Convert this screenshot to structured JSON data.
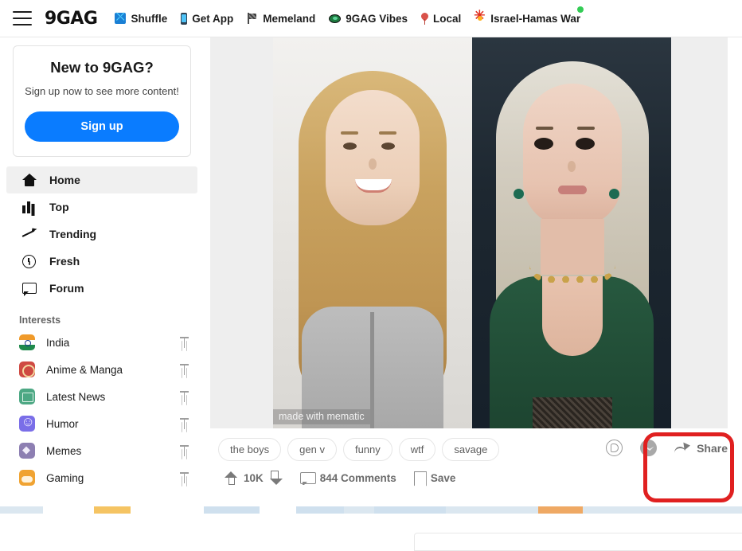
{
  "header": {
    "menu_icon": "hamburger-icon",
    "logo": "9GAG",
    "links": [
      {
        "label": "Shuffle",
        "icon": "shuffle-icon"
      },
      {
        "label": "Get App",
        "icon": "phone-icon"
      },
      {
        "label": "Memeland",
        "icon": "flag-icon"
      },
      {
        "label": "9GAG Vibes",
        "icon": "ufo-icon"
      },
      {
        "label": "Local",
        "icon": "map-pin-icon"
      },
      {
        "label": "Israel-Hamas War",
        "icon": "explosion-icon",
        "badge": "live-dot"
      }
    ]
  },
  "sidebar": {
    "signup": {
      "title": "New to 9GAG?",
      "subtitle": "Sign up now to see more content!",
      "button": "Sign up",
      "button_color": "#0a7cff"
    },
    "nav": [
      {
        "label": "Home",
        "icon": "home-icon",
        "active": true
      },
      {
        "label": "Top",
        "icon": "bar-chart-icon",
        "active": false
      },
      {
        "label": "Trending",
        "icon": "trending-up-icon",
        "active": false
      },
      {
        "label": "Fresh",
        "icon": "clock-icon",
        "active": false
      },
      {
        "label": "Forum",
        "icon": "chat-bubble-icon",
        "active": false
      }
    ],
    "interests_heading": "Interests",
    "interests": [
      {
        "label": "India",
        "icon": "india-flag-icon",
        "color": "#f09a2a",
        "pin": "pin-icon"
      },
      {
        "label": "Anime & Manga",
        "icon": "anime-icon",
        "color": "#cf4a42",
        "pin": "pin-icon"
      },
      {
        "label": "Latest News",
        "icon": "newspaper-icon",
        "color": "#4da884",
        "pin": "pin-icon"
      },
      {
        "label": "Humor",
        "icon": "mask-icon",
        "color": "#7a6ee8",
        "pin": "pin-icon"
      },
      {
        "label": "Memes",
        "icon": "diamond-icon",
        "color": "#8d7fb2",
        "pin": "pin-icon"
      },
      {
        "label": "Gaming",
        "icon": "gamepad-icon",
        "color": "#f0a332",
        "pin": "pin-icon"
      }
    ]
  },
  "post": {
    "image_alt": "side-by-side comparison portrait meme",
    "watermark": "made with mematic",
    "tags": [
      "the boys",
      "gen v",
      "funny",
      "wtf",
      "savage"
    ],
    "actions": {
      "upvote_icon": "arrow-up-icon",
      "points": "10K",
      "downvote_icon": "arrow-down-icon",
      "comments_icon": "comment-icon",
      "comments": "844 Comments",
      "save_icon": "bookmark-icon",
      "save": "Save"
    },
    "share": {
      "whatsapp_icon": "whatsapp-icon",
      "messenger_icon": "messenger-icon",
      "share_icon": "share-arrow-icon",
      "share_label": "Share"
    }
  },
  "annotation": {
    "shape": "rounded-rectangle-highlight",
    "color": "#e02020",
    "target": "Share"
  }
}
